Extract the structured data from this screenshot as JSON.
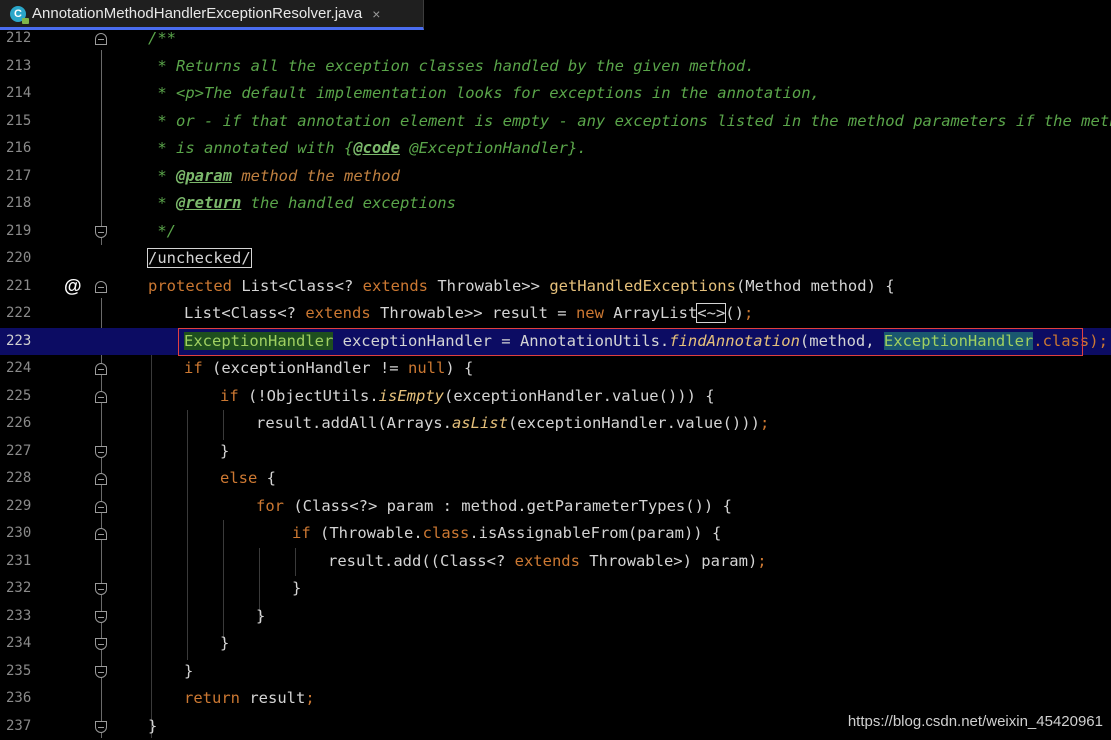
{
  "tab": {
    "filename": "AnnotationMethodHandlerExceptionResolver.java",
    "icon_letter": "C",
    "close_symbol": "×"
  },
  "editor": {
    "lines": [
      {
        "num": "212"
      },
      {
        "num": "213"
      },
      {
        "num": "214"
      },
      {
        "num": "215"
      },
      {
        "num": "216"
      },
      {
        "num": "217"
      },
      {
        "num": "218"
      },
      {
        "num": "219"
      },
      {
        "num": "220"
      },
      {
        "num": "221"
      },
      {
        "num": "222"
      },
      {
        "num": "223"
      },
      {
        "num": "224"
      },
      {
        "num": "225"
      },
      {
        "num": "226"
      },
      {
        "num": "227"
      },
      {
        "num": "228"
      },
      {
        "num": "229"
      },
      {
        "num": "230"
      },
      {
        "num": "231"
      },
      {
        "num": "232"
      },
      {
        "num": "233"
      },
      {
        "num": "234"
      },
      {
        "num": "235"
      },
      {
        "num": "236"
      },
      {
        "num": "237"
      }
    ],
    "override_marker": "@",
    "code": {
      "l212": "/**",
      "l213": " * Returns all the exception classes handled by the given method.",
      "l214": " * <p>The default implementation looks for exceptions in the annotation,",
      "l215": " * or - if that annotation element is empty - any exceptions listed in the method parameters if the method",
      "l216a": " * is annotated with {",
      "l216b": "@code",
      "l216c": " @ExceptionHandler}.",
      "l217a": " * ",
      "l217b": "@param",
      "l217c": " method the method",
      "l218a": " * ",
      "l218b": "@return",
      "l218c": " the handled exceptions",
      "l219": " */",
      "l220": "/unchecked/",
      "l221a": "protected",
      "l221b": " List<Class<? ",
      "l221c": "extends",
      "l221d": " Throwable>> ",
      "l221e": "getHandledExceptions",
      "l221f": "(Method method) {",
      "l222a": "List<Class<? ",
      "l222b": "extends",
      "l222c": " Throwable>> result = ",
      "l222d": "new",
      "l222e": " ArrayList",
      "l222f": "<~>",
      "l222g": "()",
      "l222h": ";",
      "l223a": "ExceptionHandler",
      "l223b": " exceptionHandler = AnnotationUtils.",
      "l223c": "findAnnotation",
      "l223d": "(method, ",
      "l223e": "ExceptionHandler",
      "l223f": ".class",
      "l223g": ");",
      "l224a": "if",
      "l224b": " (exceptionHandler != ",
      "l224c": "null",
      "l224d": ") {",
      "l225a": "if",
      "l225b": " (!ObjectUtils.",
      "l225c": "isEmpty",
      "l225d": "(exceptionHandler.value())) {",
      "l226a": "result.addAll(Arrays.",
      "l226b": "asList",
      "l226c": "(exceptionHandler.value()))",
      "l226d": ";",
      "l227": "}",
      "l228a": "else",
      "l228b": " {",
      "l229a": "for",
      "l229b": " (Class<?> param : method.getParameterTypes()) {",
      "l230a": "if",
      "l230b": " (Throwable.",
      "l230c": "class",
      "l230d": ".isAssignableFrom(param)) {",
      "l231a": "result.add((Class<? ",
      "l231b": "extends",
      "l231c": " Throwable>) param)",
      "l231d": ";",
      "l232": "}",
      "l233": "}",
      "l234": "}",
      "l235": "}",
      "l236a": "return",
      "l236b": " result",
      "l236c": ";",
      "l237": "}"
    }
  },
  "watermark": "https://blog.csdn.net/weixin_45420961",
  "colors": {
    "background": "#000000",
    "current_line": "#0c0c63",
    "keyword": "#cc7832",
    "method": "#e5c07b",
    "comment": "#5aa54a",
    "tab_underline": "#4a6df0",
    "error_box": "#e04040"
  }
}
